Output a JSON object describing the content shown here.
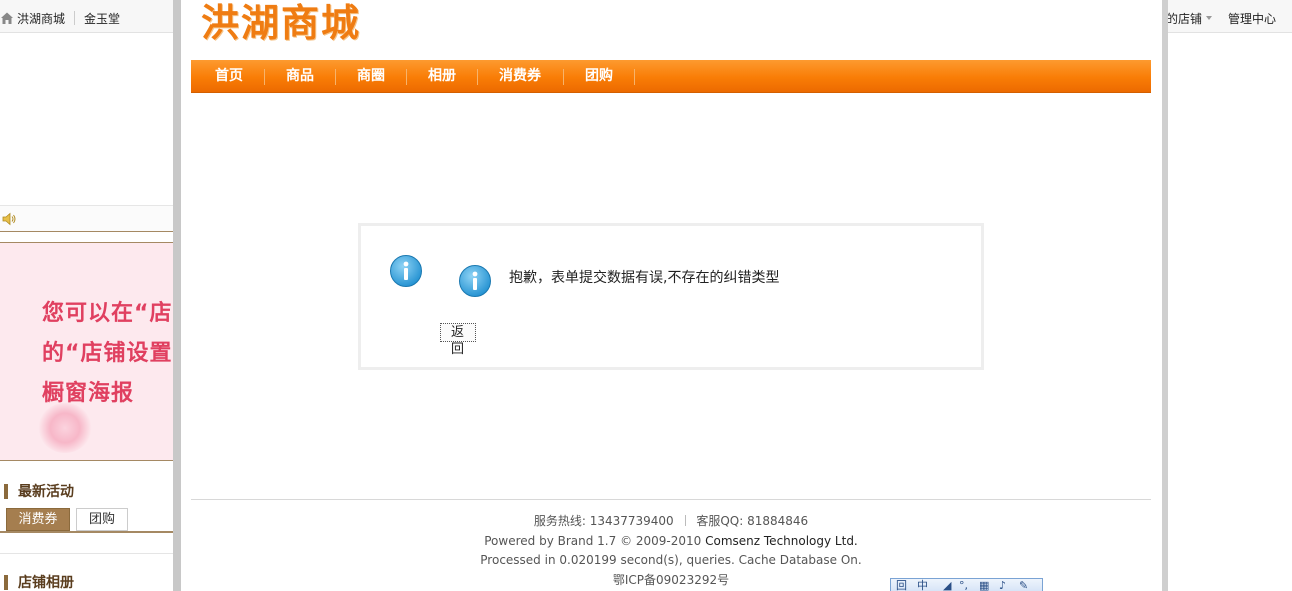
{
  "background_page": {
    "topbar": {
      "site_name": "洪湖商城",
      "shop_name": "金玉堂",
      "my_shop_partial": "的店铺",
      "admin_center": "管理中心"
    },
    "poster": {
      "line1": "您可以在“店",
      "line2": "的“店铺设置",
      "line3": "橱窗海报"
    },
    "latest_activity_title": "最新活动",
    "tabs": {
      "coupon": "消费券",
      "group_buy": "团购"
    },
    "shop_album_title": "店铺相册"
  },
  "main": {
    "logo_text": "洪湖商城",
    "nav": [
      {
        "label": "首页"
      },
      {
        "label": "商品"
      },
      {
        "label": "商圈"
      },
      {
        "label": "相册"
      },
      {
        "label": "消费券"
      },
      {
        "label": "团购"
      }
    ],
    "message": {
      "text": "抱歉，表单提交数据有误,不存在的纠错类型",
      "back_button": "返回"
    },
    "footer": {
      "hotline_label": "服务热线:",
      "hotline_value": "13437739400",
      "qq_label": "客服QQ:",
      "qq_value": "81884846",
      "powered_prefix": "Powered by Brand 1.7 © 2009-2010",
      "powered_company": "Comsenz Technology Ltd.",
      "processed": "Processed in 0.020199 second(s), queries. Cache Database On.",
      "icp": "鄂ICP备09023292号"
    }
  },
  "ime_toolbar": {
    "items": [
      "回",
      "中",
      "◢",
      "°,",
      "▦",
      "♪",
      "✎"
    ]
  },
  "colors": {
    "nav_orange": "#f97d06",
    "logo_orange": "#ef7c12",
    "info_blue": "#2a9ad8",
    "poster_red": "#e04060",
    "brown_accent": "#a57e4f"
  }
}
